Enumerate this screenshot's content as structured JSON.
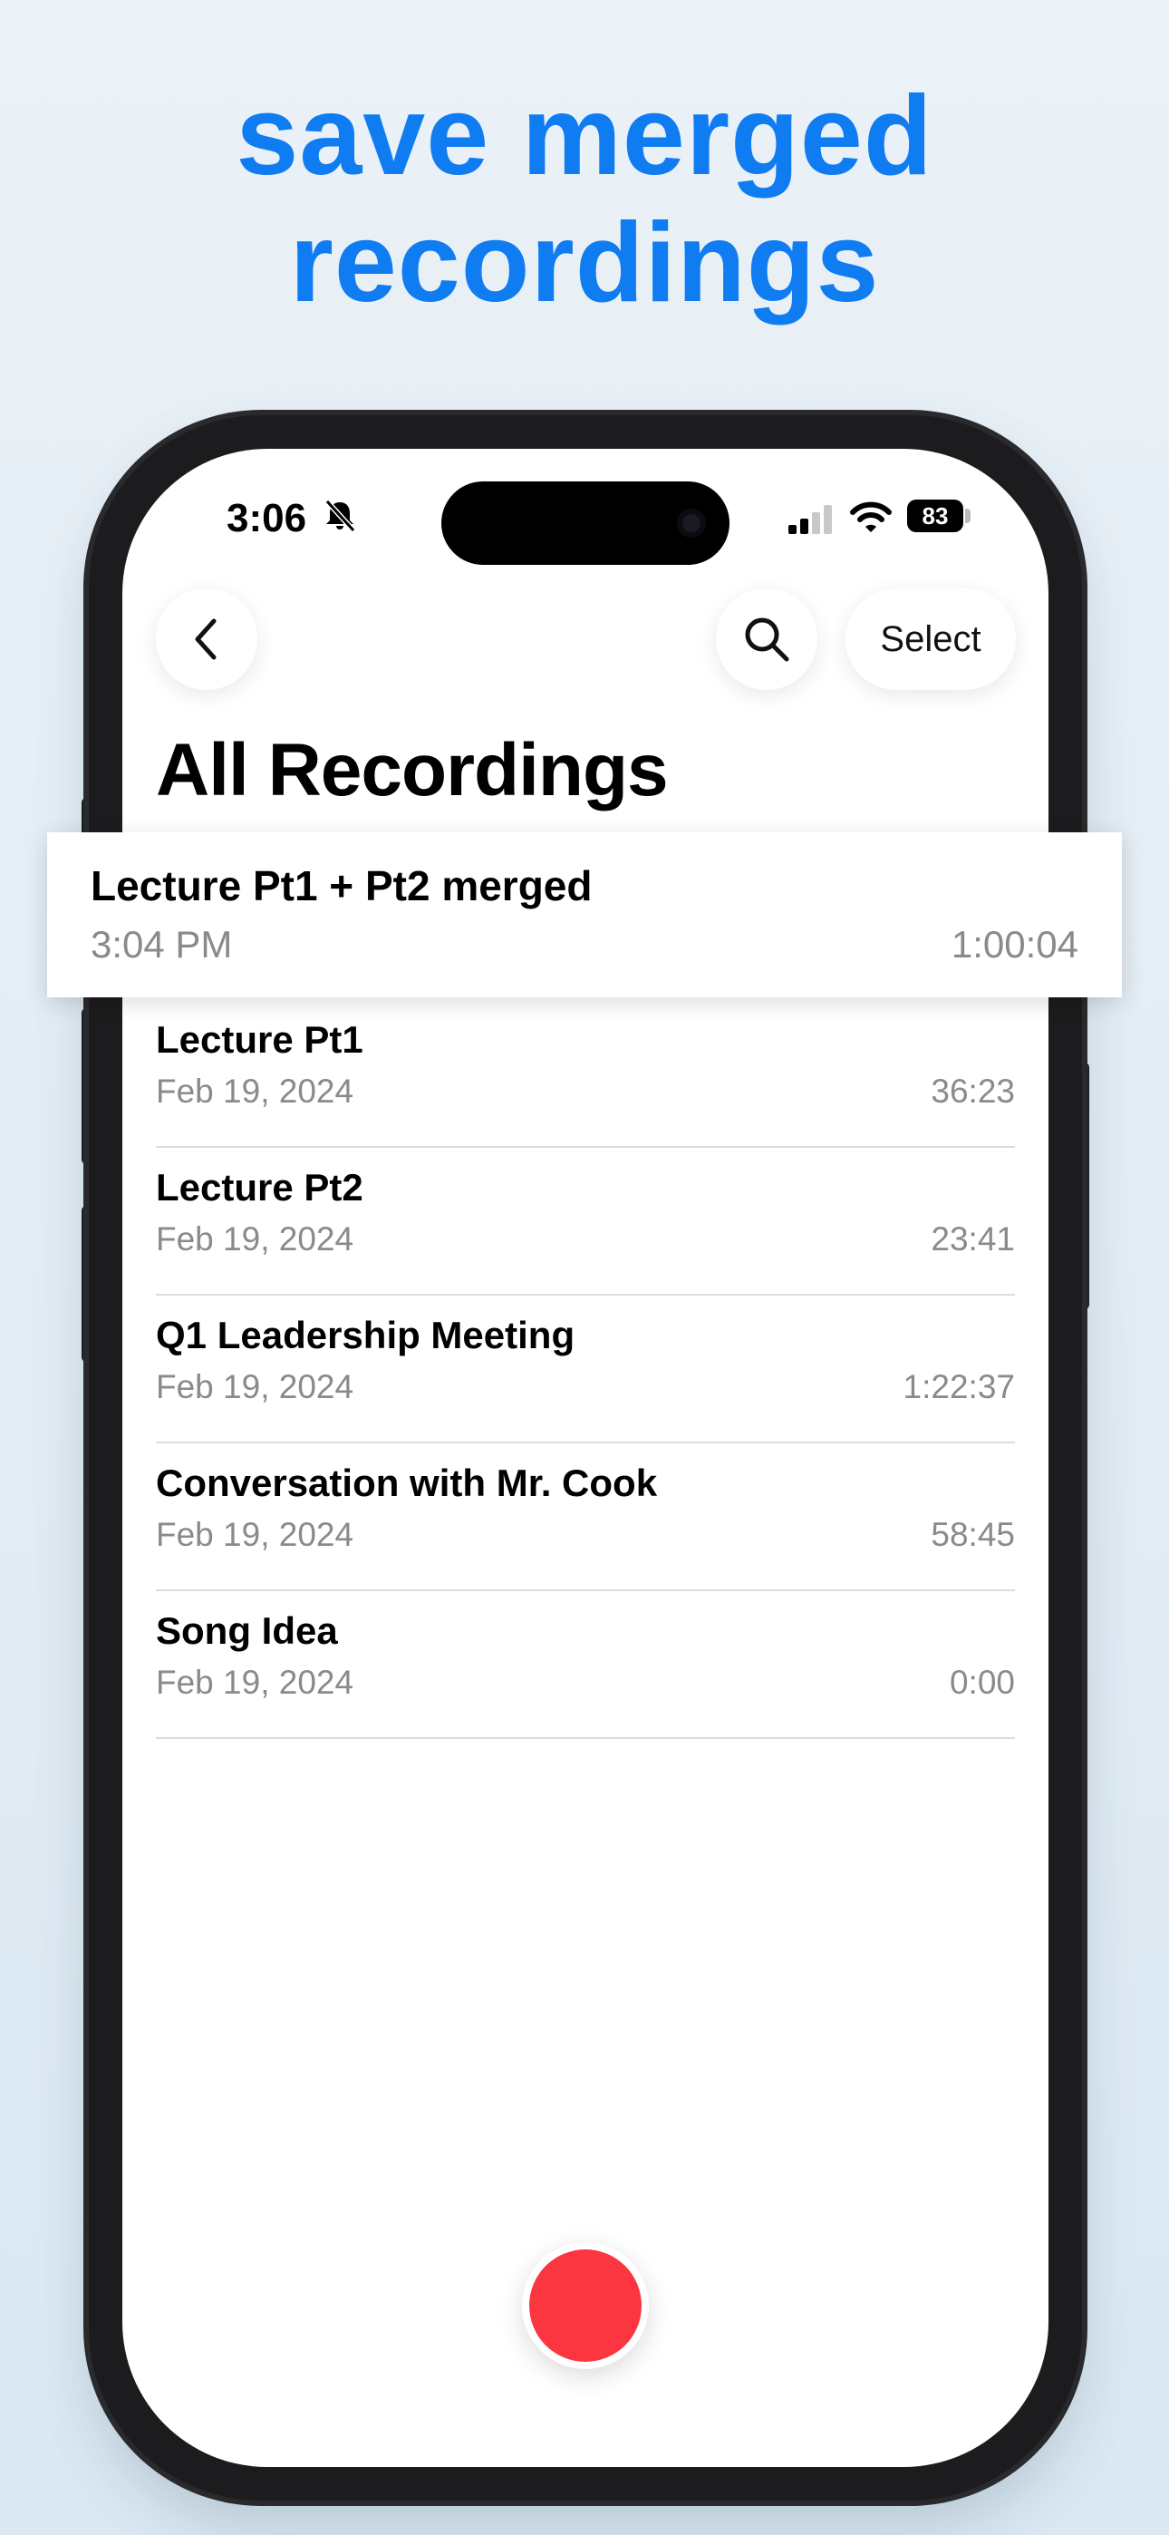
{
  "headline": {
    "line1": "save merged",
    "line2": "recordings",
    "color": "#0f7cf2"
  },
  "status_bar": {
    "time": "3:06",
    "battery": "83",
    "icons": [
      "bell-slash-icon",
      "signal-icon",
      "wifi-icon",
      "battery-icon"
    ]
  },
  "nav": {
    "back_icon": "chevron-left-icon",
    "search_icon": "search-icon",
    "select_label": "Select"
  },
  "page_title": "All Recordings",
  "highlighted": {
    "name": "Lecture Pt1 + Pt2 merged",
    "date": "3:04 PM",
    "duration": "1:00:04"
  },
  "recordings": [
    {
      "name": "Lecture Pt1",
      "date": "Feb 19, 2024",
      "duration": "36:23"
    },
    {
      "name": "Lecture Pt2",
      "date": "Feb 19, 2024",
      "duration": "23:41"
    },
    {
      "name": "Q1 Leadership Meeting",
      "date": "Feb 19, 2024",
      "duration": "1:22:37"
    },
    {
      "name": "Conversation with Mr. Cook",
      "date": "Feb 19, 2024",
      "duration": "58:45"
    },
    {
      "name": "Song Idea",
      "date": "Feb 19, 2024",
      "duration": "0:00"
    }
  ],
  "record_button": {
    "color": "#fb3640"
  }
}
